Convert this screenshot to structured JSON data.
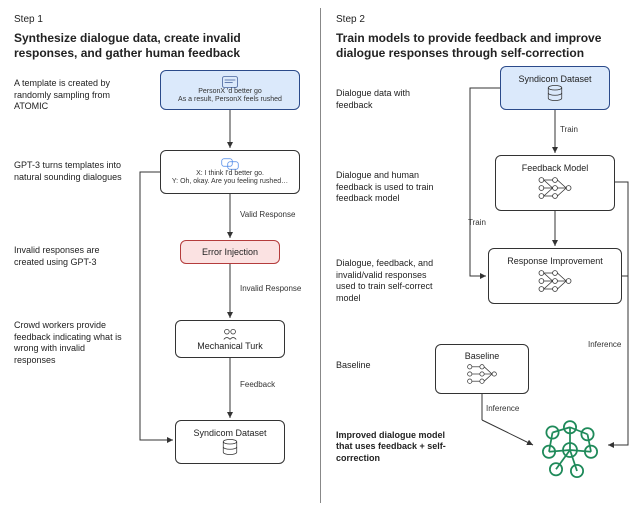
{
  "step1": {
    "label": "Step 1",
    "title": "Synthesize dialogue data, create invalid responses, and gather human feedback",
    "captions": {
      "template": "A template is created by randomly sampling from ATOMIC",
      "gpt3_dialog": "GPT-3 turns templates into natural sounding dialogues",
      "invalid": "Invalid responses are created using GPT-3",
      "crowd": "Crowd workers provide feedback indicating what is wrong with invalid responses"
    },
    "nodes": {
      "atomic_line1": "PersonX 'd better go",
      "atomic_line2": "As a result, PersonX feels rushed",
      "dialogue_line1": "X: I think I'd better go.",
      "dialogue_line2": "Y: Oh, okay. Are you feeling rushed…",
      "error_injection": "Error Injection",
      "mturk": "Mechanical Turk",
      "dataset": "Syndicom Dataset"
    },
    "arrows": {
      "valid": "Valid Response",
      "invalid": "Invalid Response",
      "feedback": "Feedback"
    }
  },
  "step2": {
    "label": "Step 2",
    "title": "Train models to provide feedback and improve dialogue responses through self-correction",
    "captions": {
      "data_with_feedback": "Dialogue data with feedback",
      "feedback_model_desc": "Dialogue and human feedback is used to train feedback model",
      "self_correct_desc": "Dialogue, feedback, and invalid/valid responses used to train self-correct model",
      "baseline": "Baseline"
    },
    "nodes": {
      "dataset": "Syndicom Dataset",
      "feedback_model": "Feedback Model",
      "response_improvement": "Response Improvement",
      "baseline": "Baseline"
    },
    "arrows": {
      "train": "Train",
      "inference": "Inference"
    },
    "final": "Improved dialogue model that uses feedback + self-correction"
  }
}
